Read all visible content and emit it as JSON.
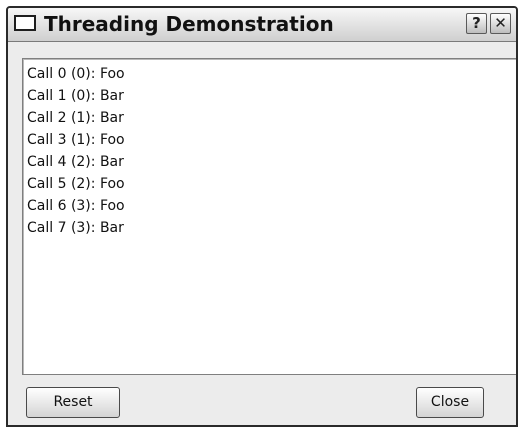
{
  "window": {
    "title": "Threading Demonstration",
    "help_label": "?",
    "close_label": "✕"
  },
  "log": {
    "items": [
      "Call 0 (0): Foo",
      "Call 1 (0): Bar",
      "Call 2 (1): Bar",
      "Call 3 (1): Foo",
      "Call 4 (2): Bar",
      "Call 5 (2): Foo",
      "Call 6 (3): Foo",
      "Call 7 (3): Bar"
    ]
  },
  "buttons": {
    "reset": "Reset",
    "close": "Close"
  },
  "icons": {
    "window_icon": "window-icon",
    "help_icon": "help-icon",
    "close_icon": "close-icon"
  }
}
